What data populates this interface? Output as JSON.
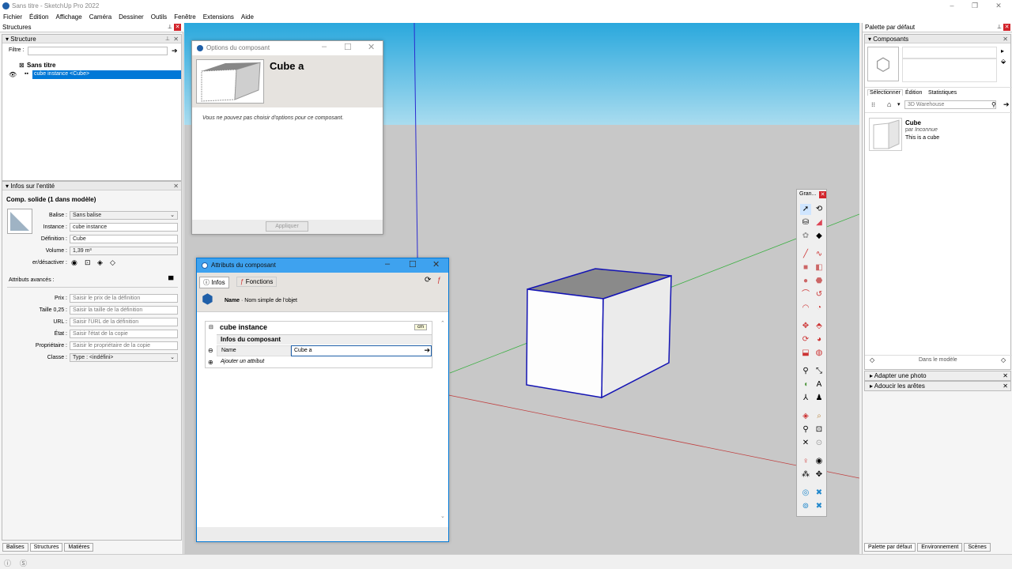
{
  "window": {
    "title": "Sans titre - SketchUp Pro 2022"
  },
  "menu": [
    "Fichier",
    "Édition",
    "Affichage",
    "Caméra",
    "Dessiner",
    "Outils",
    "Fenêtre",
    "Extensions",
    "Aide"
  ],
  "left": {
    "tray_title": "Structures",
    "structure": {
      "header": "Structure",
      "filter_label": "Filtre :",
      "root": "Sans titre",
      "item": "cube instance <Cube>"
    },
    "entity": {
      "header": "Infos sur l'entité",
      "title": "Comp. solide (1 dans modèle)",
      "rows": [
        {
          "label": "Balise :",
          "value": "Sans balise"
        },
        {
          "label": "Instance :",
          "value": "cube instance"
        },
        {
          "label": "Définition :",
          "value": "Cube"
        },
        {
          "label": "Volume :",
          "value": "1,39 m³"
        }
      ],
      "toggle_label": "er/désactiver :",
      "advanced_label": "Attributs avancés :",
      "adv_rows": [
        {
          "label": "Prix :",
          "placeholder": "Saisir le prix de la définition"
        },
        {
          "label": "Taille 0,25 :",
          "placeholder": "Saisir la taille de la définition"
        },
        {
          "label": "URL :",
          "placeholder": "Saisir l'URL de la définition"
        },
        {
          "label": "État :",
          "placeholder": "Saisir l'état de la copie"
        },
        {
          "label": "Propriétaire :",
          "placeholder": "Saisir le propriétaire de la copie"
        },
        {
          "label": "Classe :",
          "placeholder": "Type : <indéfini>"
        }
      ]
    },
    "bottom_tabs": [
      "Balises",
      "Structures",
      "Matières"
    ]
  },
  "options_dialog": {
    "title": "Options du composant",
    "name": "Cube a",
    "message": "Vous ne pouvez pas choisir d'options pour ce composant.",
    "apply": "Appliquer"
  },
  "attr_dialog": {
    "title": "Attributs du composant",
    "tabs": [
      "Infos",
      "Fonctions"
    ],
    "hint_bold": "Name",
    "hint": " · Nom simple de l'objet",
    "section": "cube instance",
    "unit": "cm",
    "subsection": "Infos du composant",
    "name_label": "Name",
    "name_value": "Cube a",
    "add_label": "Ajouter un attribut"
  },
  "toolbar": {
    "title": "Gran..."
  },
  "right": {
    "tray_title": "Palette par défaut",
    "header": "Composants",
    "tabs": [
      "Sélectionner",
      "Édition",
      "Statistiques"
    ],
    "search_placeholder": "3D Warehouse",
    "result": {
      "name": "Cube",
      "by": "par",
      "author": "Inconnue",
      "desc": "This is a cube"
    },
    "footer": "Dans le modèle",
    "collapsed": [
      "Adapter une photo",
      "Adoucir les arêtes"
    ],
    "bottom_tabs": [
      "Palette par défaut",
      "Environnement",
      "Scènes"
    ]
  },
  "colors": {
    "accent": "#0078d7",
    "sky": "#2aa8dd",
    "ground": "#c8c8c8",
    "selection_edge": "#1414b4"
  }
}
